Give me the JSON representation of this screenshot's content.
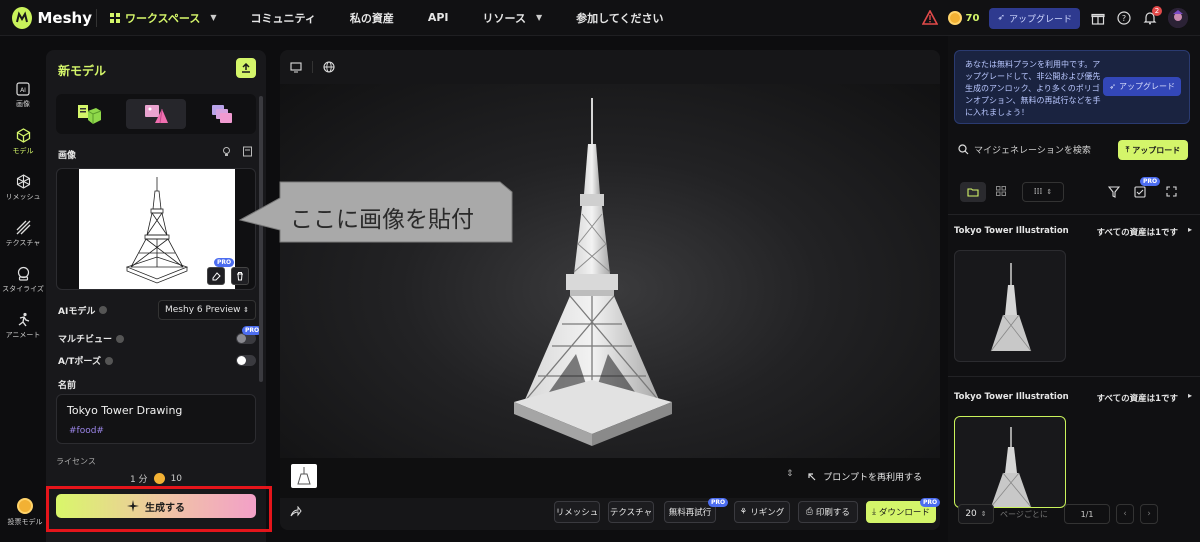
{
  "header": {
    "brand": "Meshy",
    "workspace": "ワークスペース",
    "nav": [
      "コミュニティ",
      "私の資産",
      "API",
      "リソース",
      "参加してください"
    ],
    "credits": "70",
    "upgrade": "アップグレード",
    "notifications": "2"
  },
  "rail": {
    "items": [
      {
        "label": "画像",
        "icon": "image-ai-icon"
      },
      {
        "label": "モデル",
        "icon": "cube-icon"
      },
      {
        "label": "リメッシュ",
        "icon": "remesh-icon"
      },
      {
        "label": "テクスチャ",
        "icon": "texture-icon"
      },
      {
        "label": "スタイライズ",
        "icon": "stylize-icon"
      },
      {
        "label": "アニメート",
        "icon": "running-icon"
      }
    ],
    "bottom": "投票モデル"
  },
  "panel": {
    "title": "新モデル",
    "image_label": "画像",
    "ai_model_label": "AIモデル",
    "ai_model_value": "Meshy 6 Preview",
    "multiview_label": "マルチビュー",
    "pose_label": "A/Tポーズ",
    "name_label": "名前",
    "name_value": "Tokyo Tower Drawing",
    "name_tag": "#food#",
    "license_label": "ライセンス",
    "cost_time": "1 分",
    "cost_credits": "10",
    "generate": "生成する",
    "pro": "PRO"
  },
  "viewer": {
    "callout": "ここに画像を貼付",
    "reuse_prompt": "プロンプトを再利用する",
    "tools": [
      "リメッシュ",
      "テクスチャ",
      "無料再試行",
      "リギング",
      "印刷する",
      "ダウンロード"
    ],
    "pro": "PRO"
  },
  "right": {
    "promo": "あなたは無料プランを利用中です。アップグレードして、非公開および優先生成のアンロック、より多くのポリゴンオプション、無料の再試行などを手に入れましょう！",
    "promo_button": "アップグレード",
    "search_placeholder": "マイジェネレーションを検索",
    "upload": "アップロード",
    "pro": "PRO",
    "groups": [
      {
        "title": "Tokyo Tower Illustration",
        "all": "すべての資産は1です"
      },
      {
        "title": "Tokyo Tower Illustration",
        "all": "すべての資産は1です"
      }
    ],
    "page_size": "20",
    "per_page": "ページごとに",
    "page": "1/1"
  },
  "colors": {
    "accent": "#d4f56a",
    "highlight": "#e5151b",
    "pro": "#4c6df0"
  }
}
